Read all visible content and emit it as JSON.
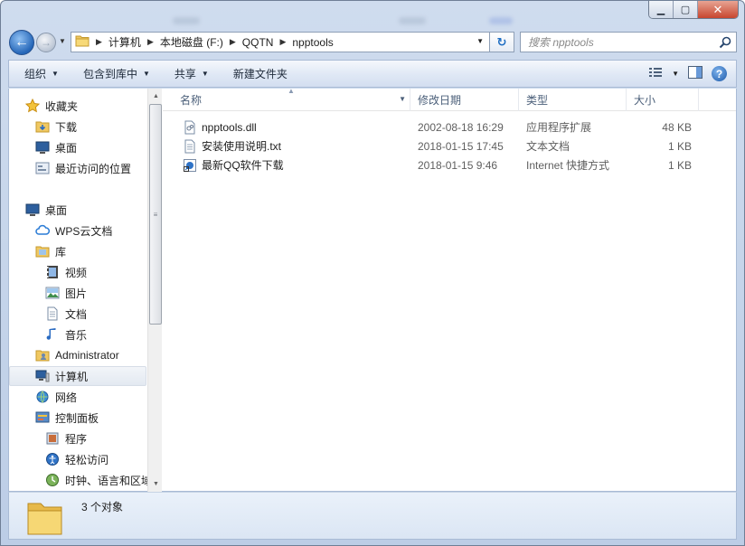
{
  "address": {
    "crumbs": [
      "计算机",
      "本地磁盘 (F:)",
      "QQTN",
      "npptools"
    ]
  },
  "search": {
    "placeholder": "搜索 npptools"
  },
  "toolbar": {
    "organize": "组织",
    "include_in_library": "包含到库中",
    "share": "共享",
    "new_folder": "新建文件夹"
  },
  "nav": {
    "favorites": "收藏夹",
    "downloads": "下载",
    "desktop_fav": "桌面",
    "recent": "最近访问的位置",
    "desktop": "桌面",
    "wps": "WPS云文档",
    "library": "库",
    "video": "视频",
    "pictures": "图片",
    "documents": "文档",
    "music": "音乐",
    "admin": "Administrator",
    "computer": "计算机",
    "network": "网络",
    "control_panel": "控制面板",
    "programs": "程序",
    "ease": "轻松访问",
    "clock": "时钟、语言和区域"
  },
  "columns": {
    "name": "名称",
    "date": "修改日期",
    "type": "类型",
    "size": "大小"
  },
  "files": [
    {
      "name": "npptools.dll",
      "date": "2002-08-18 16:29",
      "type": "应用程序扩展",
      "size": "48 KB",
      "icon": "dll-file-icon"
    },
    {
      "name": "安装使用说明.txt",
      "date": "2018-01-15 17:45",
      "type": "文本文档",
      "size": "1 KB",
      "icon": "text-file-icon"
    },
    {
      "name": "最新QQ软件下载",
      "date": "2018-01-15 9:46",
      "type": "Internet 快捷方式",
      "size": "1 KB",
      "icon": "internet-shortcut-icon"
    }
  ],
  "status": {
    "count": "3 个对象"
  },
  "colors": {
    "selection": "#e3e9f1",
    "header_text": "#4c607a",
    "accent": "#1d6dc2"
  }
}
